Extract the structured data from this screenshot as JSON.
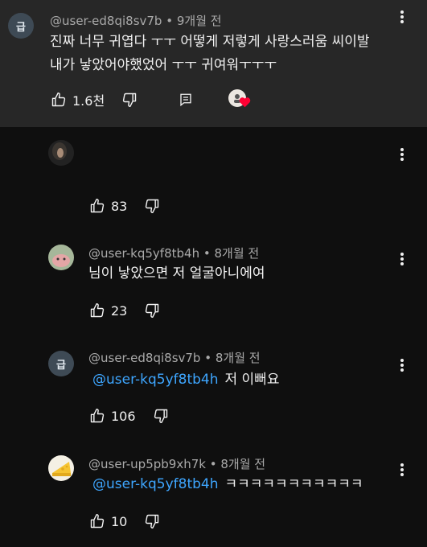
{
  "comments": [
    {
      "author": "@user-ed8qi8sv7b",
      "time": "9개월 전",
      "avatar_letter": "급",
      "text_line1": "진짜 너무 귀엽다 ㅜㅜ 어떻게 저렇게 사랑스러움 씨이발",
      "text_line2": "내가 낳았어야했었어 ㅜㅜ 귀여워ㅜㅜㅜ",
      "likes": "1.6천"
    }
  ],
  "replies": [
    {
      "author": "",
      "time": "",
      "mention": "",
      "text": "",
      "likes": "83"
    },
    {
      "author": "@user-kq5yf8tb4h",
      "time": "8개월 전",
      "mention": "",
      "text": "님이 낳았으면 저 얼굴아니에여",
      "likes": "23"
    },
    {
      "author": "@user-ed8qi8sv7b",
      "time": "8개월 전",
      "avatar_letter": "급",
      "mention": "@user-kq5yf8tb4h",
      "text": "저 이뻐요",
      "likes": "106"
    },
    {
      "author": "@user-up5pb9xh7k",
      "time": "8개월 전",
      "mention": "@user-kq5yf8tb4h",
      "text": "ㅋㅋㅋㅋㅋㅋㅋㅋㅋㅋㅋ",
      "likes": "10"
    }
  ],
  "colors": {
    "top_bg": "#272727",
    "page_bg": "#0f0f0f",
    "mention": "#3ea6ff",
    "heart": "#ff0033"
  }
}
